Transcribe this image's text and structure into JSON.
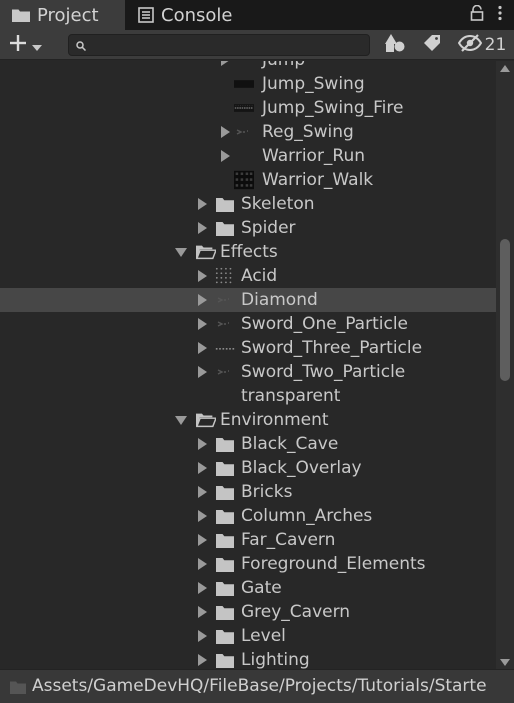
{
  "tabs": {
    "project_label": "Project",
    "console_label": "Console"
  },
  "toolbar": {
    "search_placeholder": "",
    "hidden_count": "21"
  },
  "tree": [
    {
      "label": "Jump",
      "depth": 2,
      "arrow": "collapsed",
      "icon": "none"
    },
    {
      "label": "Jump_Swing",
      "depth": 2,
      "arrow": "none",
      "icon": "sprite-dark-thumb"
    },
    {
      "label": "Jump_Swing_Fire",
      "depth": 2,
      "arrow": "none",
      "icon": "sprite-strip-thumb"
    },
    {
      "label": "Reg_Swing",
      "depth": 2,
      "arrow": "collapsed",
      "icon": "sprite-faint-thumb"
    },
    {
      "label": "Warrior_Run",
      "depth": 2,
      "arrow": "collapsed",
      "icon": "none"
    },
    {
      "label": "Warrior_Walk",
      "depth": 2,
      "arrow": "none",
      "icon": "sprite-grid-thumb"
    },
    {
      "label": "Skeleton",
      "depth": 1,
      "arrow": "collapsed",
      "icon": "folder"
    },
    {
      "label": "Spider",
      "depth": 1,
      "arrow": "collapsed",
      "icon": "folder"
    },
    {
      "label": "Effects",
      "depth": 0,
      "arrow": "expanded",
      "icon": "folder-open"
    },
    {
      "label": "Acid",
      "depth": 1,
      "arrow": "collapsed",
      "icon": "sprite-dots-thumb"
    },
    {
      "label": "Diamond",
      "depth": 1,
      "arrow": "collapsed",
      "icon": "sprite-faint-thumb",
      "selected": true
    },
    {
      "label": "Sword_One_Particle",
      "depth": 1,
      "arrow": "collapsed",
      "icon": "sprite-faint-thumb"
    },
    {
      "label": "Sword_Three_Particle",
      "depth": 1,
      "arrow": "collapsed",
      "icon": "sprite-dash-thumb"
    },
    {
      "label": "Sword_Two_Particle",
      "depth": 1,
      "arrow": "collapsed",
      "icon": "sprite-faint-thumb"
    },
    {
      "label": "transparent",
      "depth": 1,
      "arrow": "none",
      "icon": "none"
    },
    {
      "label": "Environment",
      "depth": 0,
      "arrow": "expanded",
      "icon": "folder-open"
    },
    {
      "label": "Black_Cave",
      "depth": 1,
      "arrow": "collapsed",
      "icon": "folder"
    },
    {
      "label": "Black_Overlay",
      "depth": 1,
      "arrow": "collapsed",
      "icon": "folder"
    },
    {
      "label": "Bricks",
      "depth": 1,
      "arrow": "collapsed",
      "icon": "folder"
    },
    {
      "label": "Column_Arches",
      "depth": 1,
      "arrow": "collapsed",
      "icon": "folder"
    },
    {
      "label": "Far_Cavern",
      "depth": 1,
      "arrow": "collapsed",
      "icon": "folder"
    },
    {
      "label": "Foreground_Elements",
      "depth": 1,
      "arrow": "collapsed",
      "icon": "folder"
    },
    {
      "label": "Gate",
      "depth": 1,
      "arrow": "collapsed",
      "icon": "folder"
    },
    {
      "label": "Grey_Cavern",
      "depth": 1,
      "arrow": "collapsed",
      "icon": "folder"
    },
    {
      "label": "Level",
      "depth": 1,
      "arrow": "collapsed",
      "icon": "folder"
    },
    {
      "label": "Lighting",
      "depth": 1,
      "arrow": "collapsed",
      "icon": "folder"
    }
  ],
  "path_bar": {
    "path": "Assets/GameDevHQ/FileBase/Projects/Tutorials/Starte"
  },
  "colors": {
    "background": "#282828",
    "tab_active": "#3c3c3c",
    "tab_strip": "#191919",
    "selected_row": "#474747",
    "text": "#c8c8c8"
  }
}
